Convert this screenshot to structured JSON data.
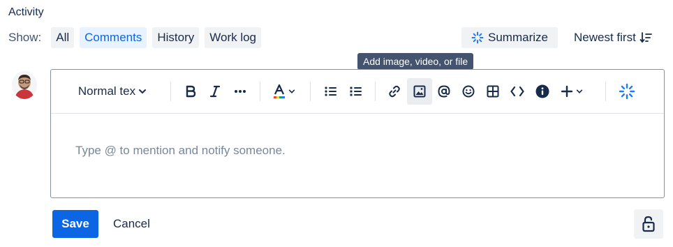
{
  "activity": {
    "title": "Activity"
  },
  "filter": {
    "show_label": "Show:",
    "options": [
      "All",
      "Comments",
      "History",
      "Work log"
    ],
    "selected": "Comments"
  },
  "summarize": {
    "label": "Summarize",
    "icon": "sparkle-icon"
  },
  "sort": {
    "label": "Newest first",
    "icon": "sort-descending-icon"
  },
  "tooltip": {
    "text": "Add image, video, or file"
  },
  "editor": {
    "text_style": "Normal tex",
    "placeholder": "Type @ to mention and notify someone.",
    "toolbar_icons": [
      "bold-icon",
      "italic-icon",
      "more-formatting-icon",
      "text-color-icon",
      "bullet-list-icon",
      "numbered-list-icon",
      "link-icon",
      "image-icon",
      "mention-icon",
      "emoji-icon",
      "table-icon",
      "code-icon",
      "info-icon",
      "insert-plus-icon",
      "ai-sparkle-icon"
    ]
  },
  "actions": {
    "save": "Save",
    "cancel": "Cancel"
  },
  "colors": {
    "accent": "#0c66e4",
    "selected_chip_bg": "#e9f2ff",
    "tooltip_bg": "#44546f",
    "avatar_bg": "#c9373d"
  }
}
